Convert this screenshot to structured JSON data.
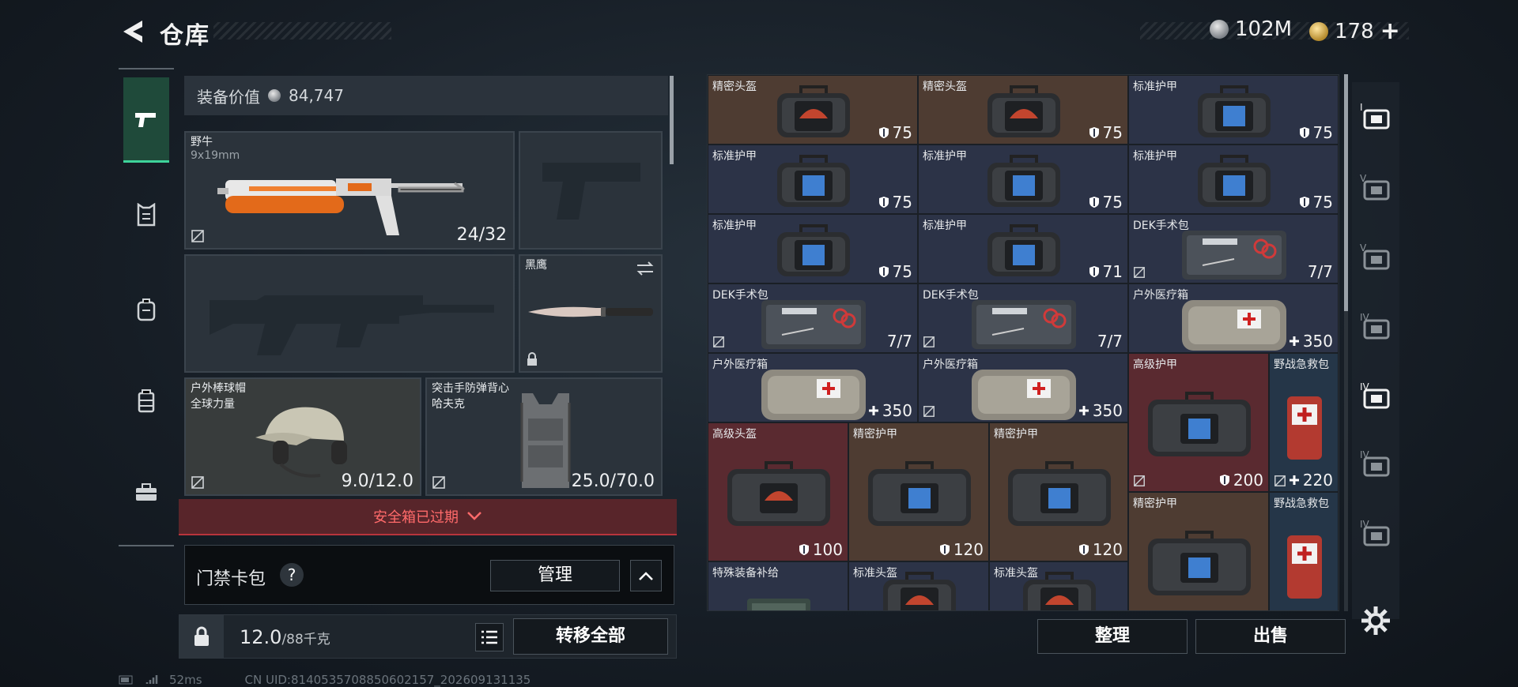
{
  "header": {
    "title": "仓库",
    "currency_silver": "102M",
    "currency_gold": "178",
    "plus": "+"
  },
  "left_nav": {
    "items": [
      "weapons",
      "armor",
      "backpack",
      "rig",
      "case"
    ]
  },
  "equipment": {
    "value_label": "装备价值",
    "value": "84,747",
    "primary": {
      "name": "野牛",
      "ammo": "9x19mm",
      "count": "24/32"
    },
    "pistol": {},
    "secondary": {},
    "melee": {
      "name": "黑鹰"
    },
    "helmet": {
      "name": "户外棒球帽",
      "sub": "全球力量",
      "count": "9.0/12.0"
    },
    "vest": {
      "name": "突击手防弹背心",
      "sub": "哈夫克",
      "count": "25.0/70.0"
    }
  },
  "safe_box": {
    "label": "安全箱已过期"
  },
  "key_bag": {
    "label": "门禁卡包",
    "help": "?",
    "manage": "管理"
  },
  "weight_bar": {
    "weight": "12.0",
    "max": "/88千克",
    "move_all": "转移全部"
  },
  "storage": {
    "items": [
      {
        "name": "精密头盔",
        "value": "75",
        "bg": "brown",
        "kind": "helmet-bag",
        "prefix": "shield"
      },
      {
        "name": "精密头盔",
        "value": "75",
        "bg": "brown",
        "kind": "helmet-bag",
        "prefix": "shield"
      },
      {
        "name": "标准护甲",
        "value": "75",
        "bg": "blue",
        "kind": "armor-bag",
        "prefix": "shield"
      },
      {
        "name": "标准护甲",
        "value": "75",
        "bg": "blue",
        "kind": "armor-bag",
        "prefix": "shield"
      },
      {
        "name": "标准护甲",
        "value": "75",
        "bg": "blue",
        "kind": "armor-bag",
        "prefix": "shield"
      },
      {
        "name": "标准护甲",
        "value": "75",
        "bg": "blue",
        "kind": "armor-bag",
        "prefix": "shield"
      },
      {
        "name": "标准护甲",
        "value": "75",
        "bg": "blue",
        "kind": "armor-bag",
        "prefix": "shield"
      },
      {
        "name": "标准护甲",
        "value": "71",
        "bg": "blue",
        "kind": "armor-bag",
        "prefix": "shield"
      },
      {
        "name": "DEK手术包",
        "value": "7/7",
        "bg": "blue",
        "kind": "surgery",
        "prefix": "none",
        "noinsure": true
      },
      {
        "name": "DEK手术包",
        "value": "7/7",
        "bg": "blue",
        "kind": "surgery",
        "prefix": "none",
        "noinsure": true
      },
      {
        "name": "DEK手术包",
        "value": "7/7",
        "bg": "blue",
        "kind": "surgery",
        "prefix": "none",
        "noinsure": true
      },
      {
        "name": "户外医疗箱",
        "value": "350",
        "bg": "blue",
        "kind": "medbox",
        "prefix": "plus"
      },
      {
        "name": "户外医疗箱",
        "value": "350",
        "bg": "blue",
        "kind": "medbox",
        "prefix": "plus"
      },
      {
        "name": "户外医疗箱",
        "value": "350",
        "bg": "blue",
        "kind": "medbox",
        "prefix": "plus",
        "noinsure": true
      },
      {
        "name": "高级护甲",
        "value": "200",
        "bg": "red",
        "kind": "armor-bag-big",
        "prefix": "shield",
        "noinsure": true
      },
      {
        "name": "野战急救包",
        "value": "220",
        "bg": "navy",
        "kind": "firstaid",
        "prefix": "plus",
        "noinsure": true
      },
      {
        "name": "高级头盔",
        "value": "100",
        "bg": "red",
        "kind": "helmet-bag-big",
        "prefix": "shield"
      },
      {
        "name": "精密护甲",
        "value": "120",
        "bg": "brown",
        "kind": "armor-bag-big",
        "prefix": "shield"
      },
      {
        "name": "精密护甲",
        "value": "120",
        "bg": "brown",
        "kind": "armor-bag-big",
        "prefix": "shield"
      },
      {
        "name": "精密护甲",
        "value": "",
        "bg": "brown",
        "kind": "armor-bag-big",
        "prefix": "none"
      },
      {
        "name": "野战急救包",
        "value": "",
        "bg": "navy",
        "kind": "firstaid",
        "prefix": "none"
      },
      {
        "name": "特殊装备补给",
        "value": "",
        "bg": "blue",
        "kind": "crate",
        "prefix": "none"
      },
      {
        "name": "标准头盔",
        "value": "",
        "bg": "blue",
        "kind": "helmet-bag",
        "prefix": "none"
      },
      {
        "name": "标准头盔",
        "value": "",
        "bg": "blue",
        "kind": "helmet-bag",
        "prefix": "none"
      }
    ],
    "sort_label": "整理",
    "sell_label": "出售"
  },
  "right_nav": {
    "items": [
      "I",
      "V",
      "V",
      "IV",
      "IV",
      "IV",
      "IV"
    ]
  },
  "footer": {
    "ping": "52ms",
    "uid": "CN UID:8140535708850602157_202609131135"
  },
  "colors": {
    "brown": "#4e3c32",
    "blue": "#2c3347",
    "red": "#5a2a30",
    "navy": "#253648",
    "accent": "#3ed39a",
    "alert": "#ff6a6a"
  }
}
